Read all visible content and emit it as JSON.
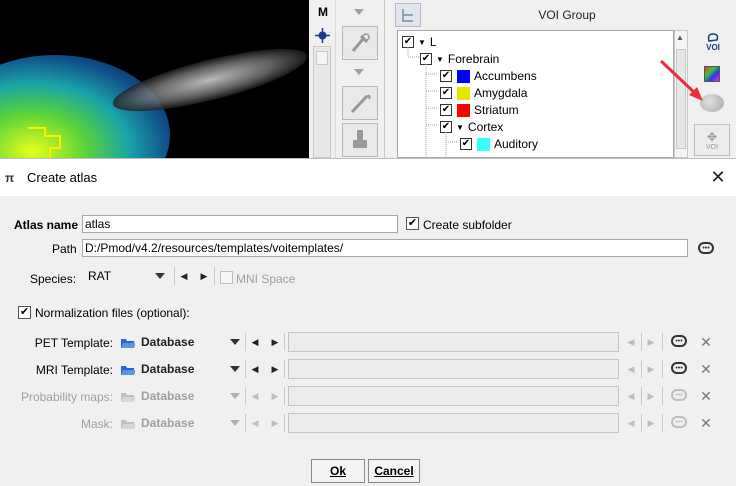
{
  "background_app": {
    "tool_letter": "M",
    "voi_group_title": "VOI Group",
    "voi_tree": [
      {
        "label": "L",
        "checked": true,
        "expanded": true,
        "level": 0,
        "color": null
      },
      {
        "label": "Forebrain",
        "checked": true,
        "expanded": true,
        "level": 1,
        "color": null
      },
      {
        "label": "Accumbens",
        "checked": true,
        "level": 2,
        "color": "#0000ff"
      },
      {
        "label": "Amygdala",
        "checked": true,
        "level": 2,
        "color": "#e6e600"
      },
      {
        "label": "Striatum",
        "checked": true,
        "level": 2,
        "color": "#ff0000"
      },
      {
        "label": "Cortex",
        "checked": true,
        "expanded": true,
        "level": 2,
        "color": null
      },
      {
        "label": "Auditory",
        "checked": true,
        "level": 3,
        "color": "#33ffff"
      }
    ],
    "right_tools": {
      "voi_label": "VOI",
      "voi_move_label": "VOI"
    }
  },
  "dialog": {
    "title": "Create atlas",
    "atlas_name_label": "Atlas name",
    "atlas_name_value": "atlas",
    "create_subfolder_label": "Create subfolder",
    "create_subfolder_checked": true,
    "path_label": "Path",
    "path_value": "D:/Pmod/v4.2/resources/templates/voitemplates/",
    "species_label": "Species:",
    "species_value": "RAT",
    "mni_space_label": "MNI Space",
    "mni_space_checked": false,
    "normalization_label": "Normalization files (optional):",
    "normalization_checked": true,
    "templates": [
      {
        "label": "PET Template:",
        "source": "Database",
        "enabled": true
      },
      {
        "label": "MRI Template:",
        "source": "Database",
        "enabled": true
      },
      {
        "label": "Probability maps:",
        "source": "Database",
        "enabled": false
      },
      {
        "label": "Mask:",
        "source": "Database",
        "enabled": false
      }
    ],
    "ok_label": "Ok",
    "cancel_label": "Cancel"
  },
  "colors": {
    "accent_arrow": "#e8303a",
    "dialog_bg": "#f0f0f0"
  }
}
